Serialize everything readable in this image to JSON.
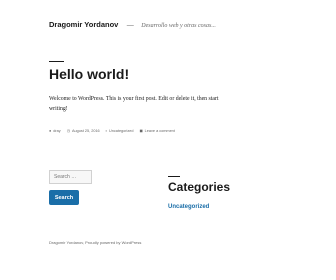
{
  "header": {
    "site_title": "Dragomir Yordanov",
    "separator": "—",
    "description": "Desarrollo web y otras cosas..."
  },
  "post": {
    "title": "Hello world!",
    "content": "Welcome to WordPress. This is your first post. Edit or delete it, then start writing!",
    "meta": {
      "author": "dray",
      "date": "August 25, 2016",
      "category": "Uncategorized",
      "comments": "Leave a comment"
    },
    "icons": {
      "author": "user-icon",
      "date": "clock-icon",
      "category": "folder-icon",
      "comments": "comment-icon"
    }
  },
  "sidebar": {
    "search_placeholder": "Search …",
    "search_button": "Search",
    "categories_title": "Categories",
    "categories": [
      "Uncategorized"
    ]
  },
  "footer": {
    "text": "Dragomir Yordanov, Proudly powered by WordPress"
  },
  "colors": {
    "accent": "#1a6ea8",
    "text": "#1a1a1a",
    "muted": "#686868"
  }
}
